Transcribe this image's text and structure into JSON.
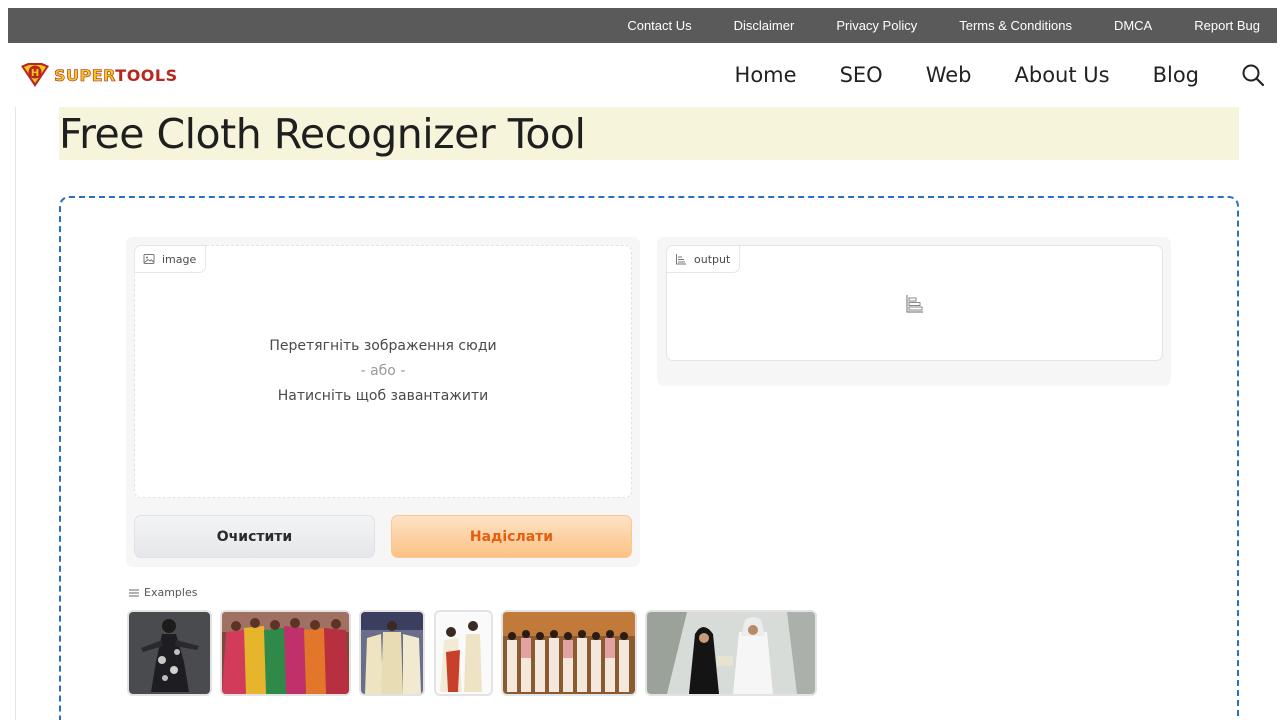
{
  "topbar": {
    "links": [
      "Contact Us",
      "Disclaimer",
      "Privacy Policy",
      "Terms & Conditions",
      "DMCA",
      "Report Bug"
    ]
  },
  "header": {
    "logo": {
      "letter": "H",
      "text_part1": "SUPER",
      "text_part2": "TOOLS"
    },
    "nav": [
      "Home",
      "SEO",
      "Web",
      "About Us",
      "Blog"
    ],
    "search_icon": "search-icon"
  },
  "page": {
    "title": "Free Cloth Recognizer Tool"
  },
  "tool": {
    "image_label": "image",
    "drop_text": "Перетягніть зображення сюди",
    "or_text": "- або -",
    "click_text": "Натисніть щоб завантажити",
    "clear_button": "Очистити",
    "submit_button": "Надіслати",
    "output_label": "output",
    "examples_label": "Examples"
  },
  "colors": {
    "topbar_bg": "#5a5a5a",
    "title_highlight": "#f6f5dc",
    "container_border": "#2a6fc4",
    "submit_text": "#e35f10",
    "submit_bg": "#fcc185",
    "logo_red": "#b8261d",
    "logo_yellow": "#f2c81f"
  }
}
